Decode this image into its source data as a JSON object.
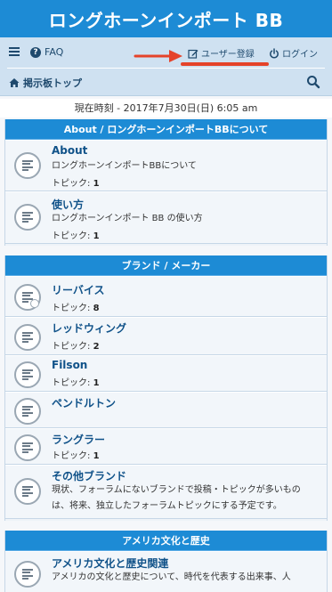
{
  "header": {
    "title": "ロングホーンインポート BB"
  },
  "nav": {
    "faq": "FAQ",
    "register": "ユーザー登録",
    "login": "ログイン",
    "home": "掲示板トップ"
  },
  "time": {
    "text": "現在時刻 - 2017年7月30日(日) 6:05 am"
  },
  "topics_label": "トピック:",
  "sections": [
    {
      "title": "About / ロングホーンインポートBBについて",
      "forums": [
        {
          "title": "About",
          "desc": "ロングホーンインポートBBについて",
          "topics": "1"
        },
        {
          "title": "使い方",
          "desc": "ロングホーンインポート BB の使い方",
          "topics": "1"
        }
      ]
    },
    {
      "title": "ブランド / メーカー",
      "forums": [
        {
          "title": "リーバイス",
          "topics": "8"
        },
        {
          "title": "レッドウィング",
          "topics": "2"
        },
        {
          "title": "Filson",
          "topics": "1"
        },
        {
          "title": "ペンドルトン"
        },
        {
          "title": "ラングラー",
          "topics": "1"
        },
        {
          "title": "その他ブランド",
          "desc1": "現状、フォーラムにないブランドで投稿・トピックが多いもの",
          "desc2": "は、将来、独立したフォーラムトピックにする予定です。"
        }
      ]
    },
    {
      "title": "アメリカ文化と歴史",
      "forums": [
        {
          "title": "アメリカ文化と歴史関連",
          "desc": "アメリカの文化と歴史について、時代を代表する出来事、人"
        }
      ]
    }
  ],
  "colors": {
    "header_blue": "#1d8bd5",
    "nav_bg": "#cfe1f1",
    "link": "#105289",
    "annotation_red": "#e5432a"
  },
  "icons": [
    "menu-icon",
    "question-circle-icon",
    "pencil-square-icon",
    "power-icon",
    "home-icon",
    "search-icon",
    "forum-read-icon",
    "forum-subforum-icon",
    "arrow-annotation"
  ]
}
